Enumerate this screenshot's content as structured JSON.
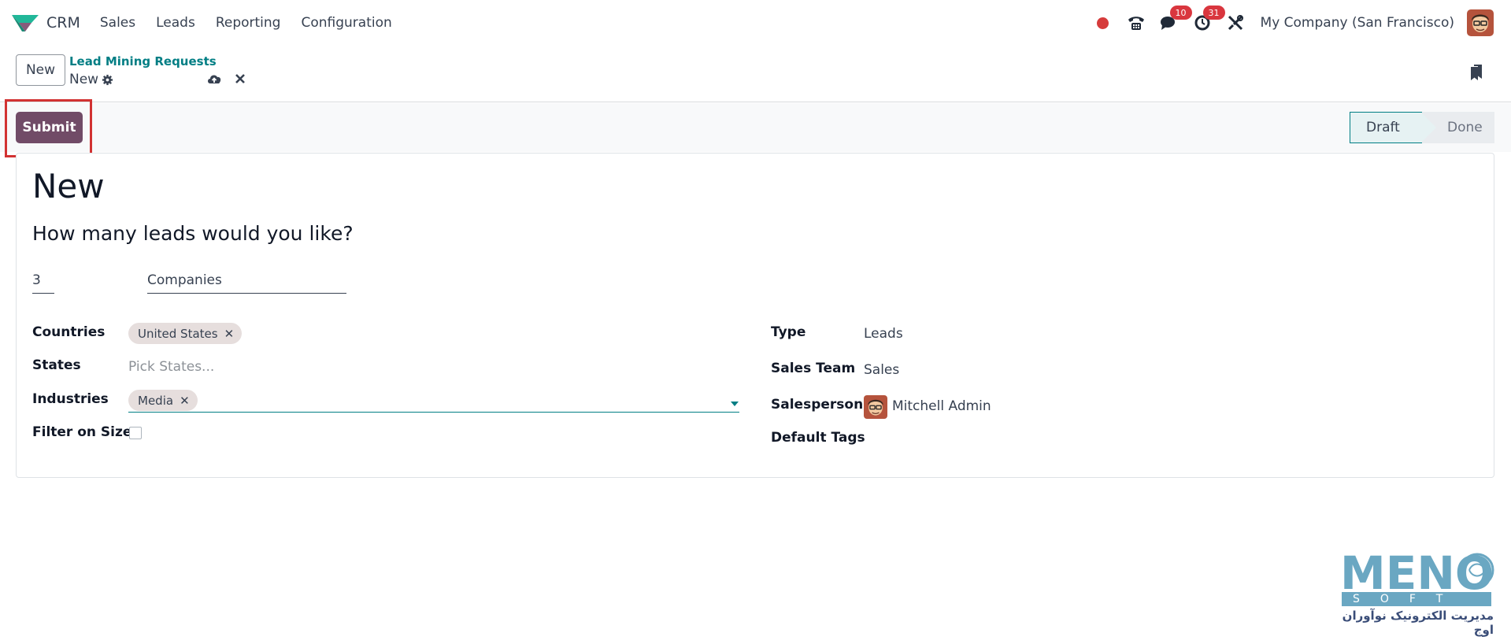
{
  "app": {
    "name": "CRM",
    "menu": [
      "Sales",
      "Leads",
      "Reporting",
      "Configuration"
    ]
  },
  "systray": {
    "messages_count": "10",
    "activities_count": "31",
    "company": "My Company (San Francisco)"
  },
  "control_panel": {
    "new_button": "New",
    "breadcrumb_parent": "Lead Mining Requests",
    "breadcrumb_current": "New"
  },
  "statusbar": {
    "submit_label": "Submit",
    "stages": [
      "Draft",
      "Done"
    ],
    "active_stage": "Draft"
  },
  "form": {
    "record_name": "New",
    "question": "How many leads would you like?",
    "lead_count": "3",
    "search_type": "Companies",
    "labels": {
      "countries": "Countries",
      "states": "States",
      "industries": "Industries",
      "filter_on_size": "Filter on Size",
      "type": "Type",
      "sales_team": "Sales Team",
      "salesperson": "Salesperson",
      "default_tags": "Default Tags"
    },
    "countries_tags": [
      "United States"
    ],
    "states_placeholder": "Pick States...",
    "industries_tags": [
      "Media"
    ],
    "filter_on_size": false,
    "type_value": "Leads",
    "sales_team_value": "Sales",
    "salesperson_value": "Mitchell Admin"
  },
  "watermark": {
    "logo_text": "MENO",
    "sub_text": "SOFT",
    "persian_text": "مدیریت الکترونیک نوآوران اوج"
  },
  "colors": {
    "primary": "#714b67",
    "accent": "#017e84",
    "badge": "#d9363e",
    "highlight_box": "#d23232"
  },
  "icons": [
    "crm-logo-icon",
    "record-dot-icon",
    "phone-icon",
    "chat-icon",
    "clock-icon",
    "tools-icon",
    "gear-icon",
    "cloud-upload-icon",
    "close-icon",
    "bookmark-icon",
    "chevron-down-icon"
  ]
}
